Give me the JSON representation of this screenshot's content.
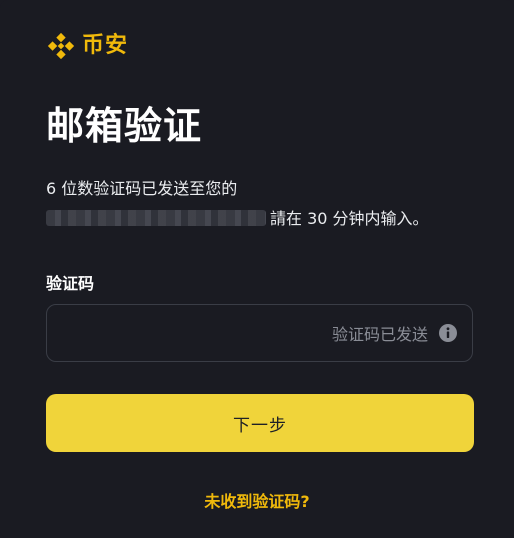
{
  "brand": {
    "name": "币安",
    "logo_icon": "binance-logo-icon",
    "accent_color": "#f0b90b"
  },
  "page": {
    "title": "邮箱验证",
    "description_line1": "6 位数验证码已发送至您的",
    "description_line2_suffix": "請在 30 分钟内输入。"
  },
  "form": {
    "code_label": "验证码",
    "code_value": "",
    "code_status": "验证码已发送",
    "status_icon": "info-icon"
  },
  "actions": {
    "next_label": "下一步",
    "next_color": "#f0d43a",
    "resend_label": "未收到验证码?"
  }
}
